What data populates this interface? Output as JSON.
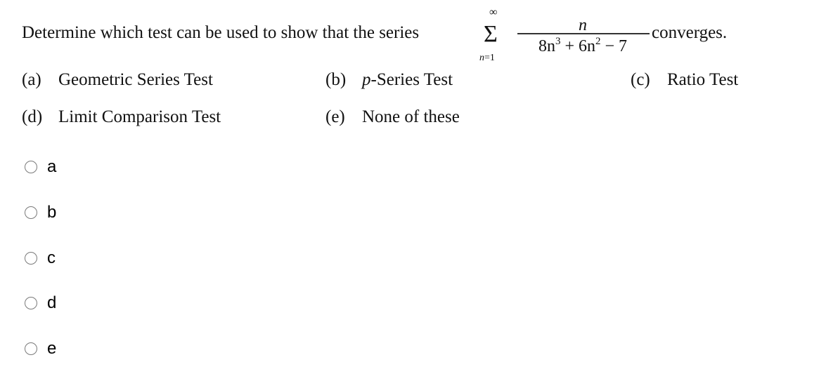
{
  "question": {
    "stem": "Determine which test can be used to show that the series",
    "series": {
      "sigma": "Σ",
      "upper": "∞",
      "lower_var": "n",
      "lower_eq": "=1",
      "numerator": "n",
      "denominator": {
        "t1_coef": "8n",
        "t1_exp": "3",
        "plus": " + ",
        "t2_coef": "6n",
        "t2_exp": "2",
        "minus": " − 7"
      }
    },
    "ending": "converges.",
    "options": [
      {
        "label": "(a)",
        "text": "Geometric Series Test"
      },
      {
        "label": "(b)",
        "prefix": "p",
        "text": "-Series Test"
      },
      {
        "label": "(c)",
        "text": "Ratio Test"
      },
      {
        "label": "(d)",
        "text": "Limit Comparison Test"
      },
      {
        "label": "(e)",
        "text": "None of these"
      }
    ]
  },
  "answers": [
    {
      "value": "a",
      "selected": false
    },
    {
      "value": "b",
      "selected": false
    },
    {
      "value": "c",
      "selected": false
    },
    {
      "value": "d",
      "selected": false
    },
    {
      "value": "e",
      "selected": false
    }
  ]
}
